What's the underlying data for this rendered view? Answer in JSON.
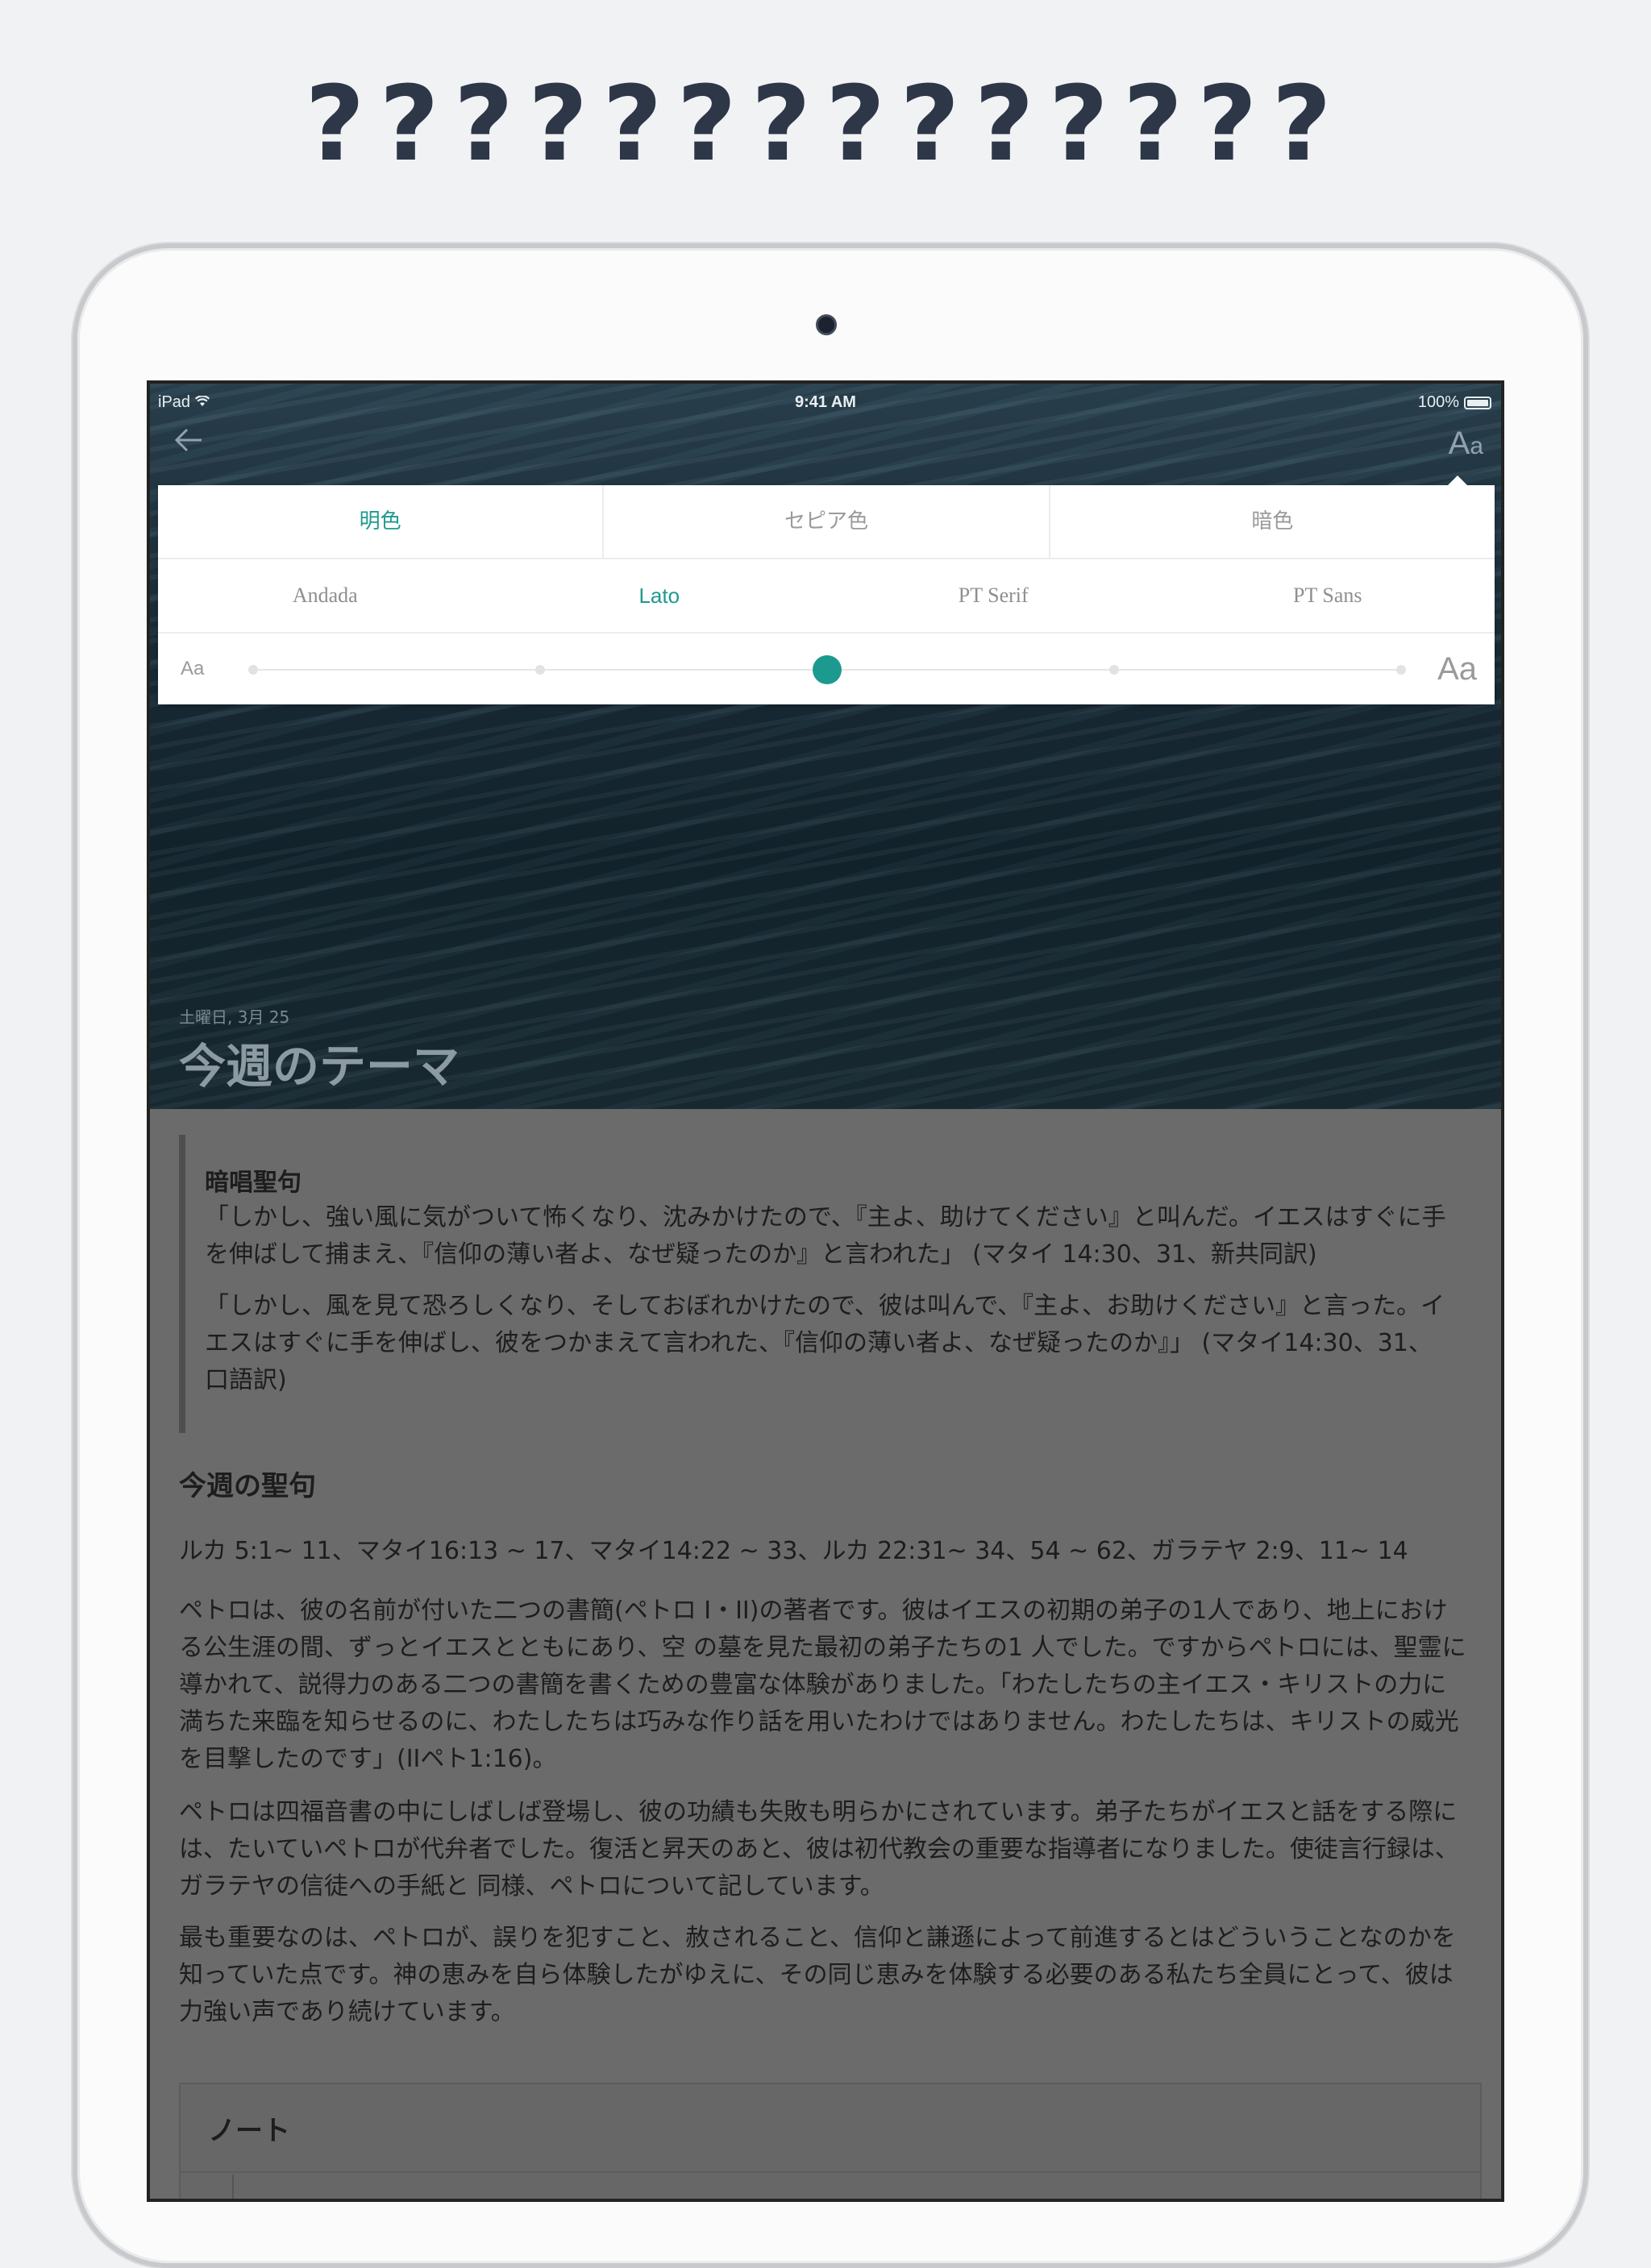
{
  "headline": "??????????????",
  "status": {
    "device": "iPad",
    "time": "9:41 AM",
    "battery": "100%"
  },
  "nav": {
    "aa_label": "A",
    "aa_small": "a"
  },
  "settings": {
    "themes": [
      {
        "label": "明色"
      },
      {
        "label": "セピア色"
      },
      {
        "label": "暗色"
      }
    ],
    "active_theme": 0,
    "fonts": [
      {
        "label": "Andada"
      },
      {
        "label": "Lato"
      },
      {
        "label": "PT Serif"
      },
      {
        "label": "PT Sans"
      }
    ],
    "active_font": 1,
    "size_small_label": "Aa",
    "size_large_label": "Aa",
    "size_level": 3,
    "size_levels": 5,
    "accent": "#1d9a8f"
  },
  "hero": {
    "date": "土曜日, 3月 25",
    "title": "今週のテーマ"
  },
  "content": {
    "memory_title": "暗唱聖句",
    "memory_p1": "「しかし、強い風に気がついて怖くなり、沈みかけたので、『主よ、助けてください』と叫んだ。イエスはすぐに手を伸ばして捕まえ、『信仰の薄い者よ、なぜ疑ったのか』と言われた」 (マタイ 14:30、31、新共同訳)",
    "memory_p2": "「しかし、風を見て恐ろしくなり、そしておぼれかけたので、彼は叫んで、『主よ、お助けください』と言った。イエスはすぐに手を伸ばし、彼をつかまえて言われた、『信仰の薄い者よ、なぜ疑ったのか』」 (マタイ14:30、31、口語訳)",
    "scripture_title": "今週の聖句",
    "scripture_refs": "ルカ 5:1~ 11、マタイ16:13 ~ 17、マタイ14:22 ~ 33、ルカ 22:31~ 34、54 ~ 62、ガラテヤ 2:9、11~ 14",
    "para1": "ペトロは、彼の名前が付いた二つの書簡(ペトロ I・II)の著者です。彼はイエスの初期の弟子の1人であり、地上における公生涯の間、ずっとイエスとともにあり、空 の墓を見た最初の弟子たちの1 人でした。ですからペトロには、聖霊に導かれて、説得力のある二つの書簡を書くための豊富な体験がありました。「わたしたちの主イエス・キリストの力に満ちた来臨を知らせるのに、わたしたちは巧みな作り話を用いたわけではありません。わたしたちは、キリストの威光を目撃したのです」(IIペト1:16)。",
    "para2": "ペトロは四福音書の中にしばしば登場し、彼の功績も失敗も明らかにされています。弟子たちがイエスと話をする際には、たいていペトロが代弁者でした。復活と昇天のあと、彼は初代教会の重要な指導者になりました。使徒言行録は、ガラテヤの信徒への手紙と 同様、ペトロについて記しています。",
    "para3": "最も重要なのは、ペトロが、誤りを犯すこと、赦されること、信仰と謙遜によって前進するとはどういうことなのかを知っていた点です。神の恵みを自ら体験したがゆえに、その同じ恵みを体験する必要のある私たち全員にとって、彼は力強い声であり続けています。",
    "notes_title": "ノート"
  }
}
